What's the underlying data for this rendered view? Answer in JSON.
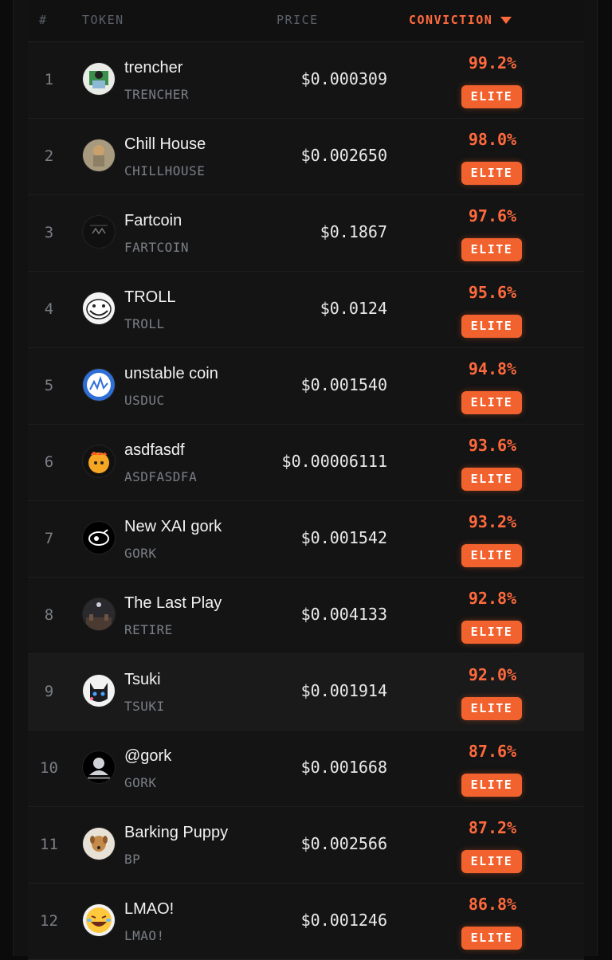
{
  "header": {
    "rank": "#",
    "token": "TOKEN",
    "price": "PRICE",
    "conviction": "CONVICTION",
    "sort_icon": "triangle-down-icon"
  },
  "accent_color": "#ff6a3d",
  "badge_color": "#f2622e",
  "rows": [
    {
      "rank": "1",
      "name": "trencher",
      "symbol": "TRENCHER",
      "price": "$0.000309",
      "conviction": "99.2%",
      "tier": "ELITE"
    },
    {
      "rank": "2",
      "name": "Chill House",
      "symbol": "CHILLHOUSE",
      "price": "$0.002650",
      "conviction": "98.0%",
      "tier": "ELITE"
    },
    {
      "rank": "3",
      "name": "Fartcoin",
      "symbol": "FARTCOIN",
      "price": "$0.1867",
      "conviction": "97.6%",
      "tier": "ELITE"
    },
    {
      "rank": "4",
      "name": "TROLL",
      "symbol": "TROLL",
      "price": "$0.0124",
      "conviction": "95.6%",
      "tier": "ELITE"
    },
    {
      "rank": "5",
      "name": "unstable coin",
      "symbol": "USDUC",
      "price": "$0.001540",
      "conviction": "94.8%",
      "tier": "ELITE"
    },
    {
      "rank": "6",
      "name": "asdfasdf",
      "symbol": "ASDFASDFA",
      "price": "$0.00006111",
      "conviction": "93.6%",
      "tier": "ELITE"
    },
    {
      "rank": "7",
      "name": "New XAI gork",
      "symbol": "GORK",
      "price": "$0.001542",
      "conviction": "93.2%",
      "tier": "ELITE"
    },
    {
      "rank": "8",
      "name": "The Last Play",
      "symbol": "RETIRE",
      "price": "$0.004133",
      "conviction": "92.8%",
      "tier": "ELITE"
    },
    {
      "rank": "9",
      "name": "Tsuki",
      "symbol": "TSUKI",
      "price": "$0.001914",
      "conviction": "92.0%",
      "tier": "ELITE"
    },
    {
      "rank": "10",
      "name": "@gork",
      "symbol": "GORK",
      "price": "$0.001668",
      "conviction": "87.6%",
      "tier": "ELITE"
    },
    {
      "rank": "11",
      "name": "Barking Puppy",
      "symbol": "BP",
      "price": "$0.002566",
      "conviction": "87.2%",
      "tier": "ELITE"
    },
    {
      "rank": "12",
      "name": "LMAO!",
      "symbol": "LMAO!",
      "price": "$0.001246",
      "conviction": "86.8%",
      "tier": "ELITE"
    }
  ]
}
